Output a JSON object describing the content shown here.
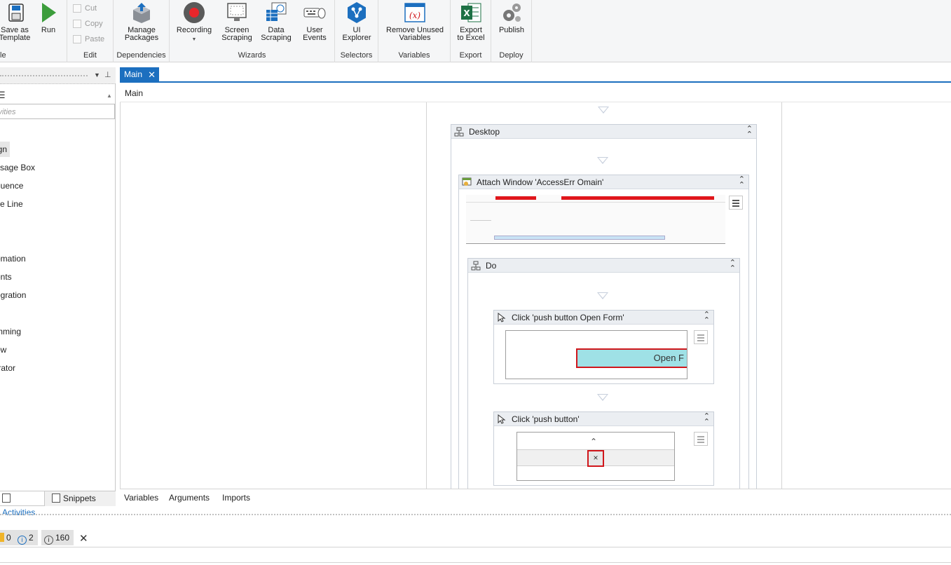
{
  "ribbon": {
    "save_template": "Save as\nTemplate",
    "run": "Run",
    "group_file": "le",
    "cut": "Cut",
    "copy": "Copy",
    "paste": "Paste",
    "group_edit": "Edit",
    "manage_packages": "Manage\nPackages",
    "group_dependencies": "Dependencies",
    "recording": "Recording",
    "screen_scraping": "Screen\nScraping",
    "data_scraping": "Data\nScraping",
    "user_events": "User\nEvents",
    "group_wizards": "Wizards",
    "ui_explorer": "UI\nExplorer",
    "group_selectors": "Selectors",
    "remove_unused": "Remove Unused\nVariables",
    "group_variables": "Variables",
    "export_excel": "Export\nto Excel",
    "group_export": "Export",
    "publish": "Publish",
    "group_deploy": "Deploy"
  },
  "left_panel": {
    "search_placeholder": "ivities",
    "items": [
      "ign",
      "ssage Box",
      "quence",
      "ite Line",
      "omation",
      "ents",
      "egration",
      "mming",
      "ow",
      "trator"
    ],
    "tab_activities": "Activities",
    "tab_snippets": "Snippets"
  },
  "document": {
    "tab_label": "Main",
    "breadcrumb": "Main"
  },
  "workflow": {
    "desktop_title": "Desktop",
    "attach_title": "Attach Window 'AccessErr Omain'",
    "do_title": "Do",
    "click1_title": "Click 'push button  Open Form'",
    "click1_preview_text": "Open F",
    "click2_title": "Click 'push button'",
    "click2_preview_x": "×"
  },
  "bottom_tabs": {
    "variables": "Variables",
    "arguments": "Arguments",
    "imports": "Imports"
  },
  "status": {
    "warnings": "0",
    "info": "2",
    "messages": "160"
  },
  "colors": {
    "accent": "#1c6fbf",
    "highlight_red": "#d0161b",
    "button_cyan": "#9fe1e6"
  }
}
